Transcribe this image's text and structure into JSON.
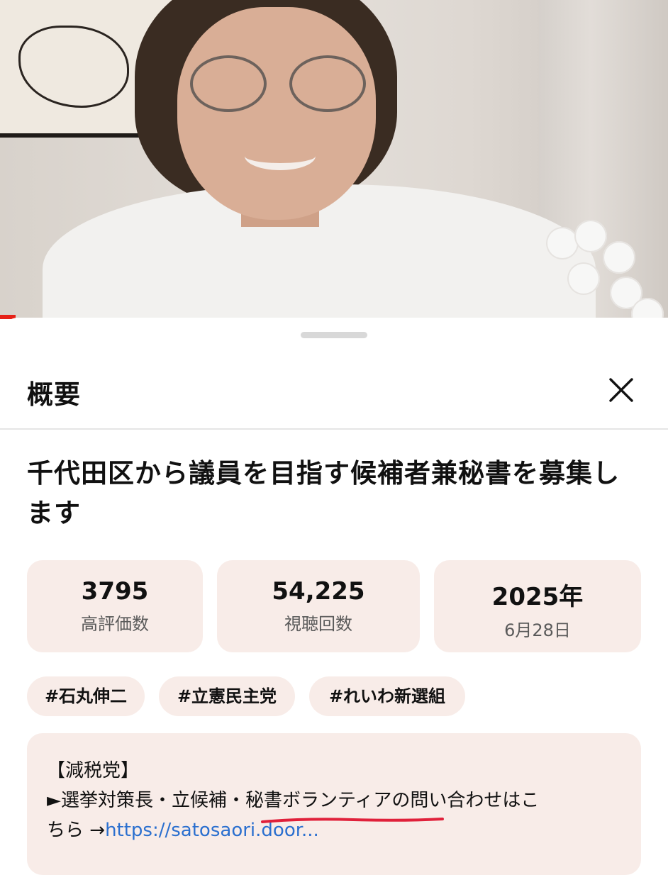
{
  "sheet": {
    "title": "概要",
    "close_label": "×"
  },
  "video": {
    "title": "千代田区から議員を目指す候補者兼秘書を募集します"
  },
  "stats": [
    {
      "value": "3795",
      "label": "高評価数"
    },
    {
      "value": "54,225",
      "label": "視聴回数"
    },
    {
      "value": "2025年",
      "label": "6月28日"
    }
  ],
  "tags": [
    "#石丸伸二",
    "#立憲民主党",
    "#れいわ新選組"
  ],
  "description": {
    "line1": "【減税党】",
    "line2": "►選挙対策長・立候補・秘書ボランティアの問い合わせはこ",
    "line3_prefix": "ちら →",
    "link": "https://satosaori.door..."
  },
  "colors": {
    "accent_red": "#e62117",
    "chip_bg": "#f8ece8",
    "link": "#2a6fcf",
    "annotation_red": "#e0203a"
  },
  "icons": {
    "close": "close-icon"
  }
}
